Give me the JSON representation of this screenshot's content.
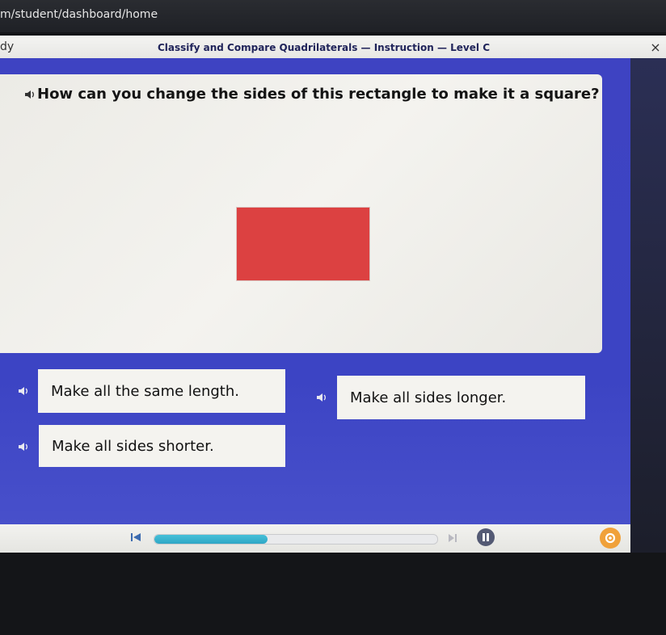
{
  "browser": {
    "url": "m/student/dashboard/home"
  },
  "app": {
    "left_crop_text": "dy",
    "title": "Classify and Compare Quadrilaterals — Instruction — Level C",
    "close_symbol": "×"
  },
  "question": {
    "text": "How can you change the sides of this rectangle to make it a square?",
    "shape_color": "#dc4141"
  },
  "answers": [
    {
      "label": "Make all the same length."
    },
    {
      "label": "Make all sides longer."
    },
    {
      "label": "Make all sides shorter."
    }
  ],
  "player": {
    "progress": 0.4
  },
  "colors": {
    "stage_blue": "#3e43c2",
    "card_bg": "#f4f3ef",
    "accent_orange": "#f0a13a",
    "progress_teal": "#2fa7c6"
  },
  "icons": {
    "speaker": "speaker-icon",
    "rewind": "rewind-icon",
    "skip": "skip-forward-icon",
    "pause": "pause-icon",
    "settings": "gear-icon",
    "close": "close-icon"
  }
}
